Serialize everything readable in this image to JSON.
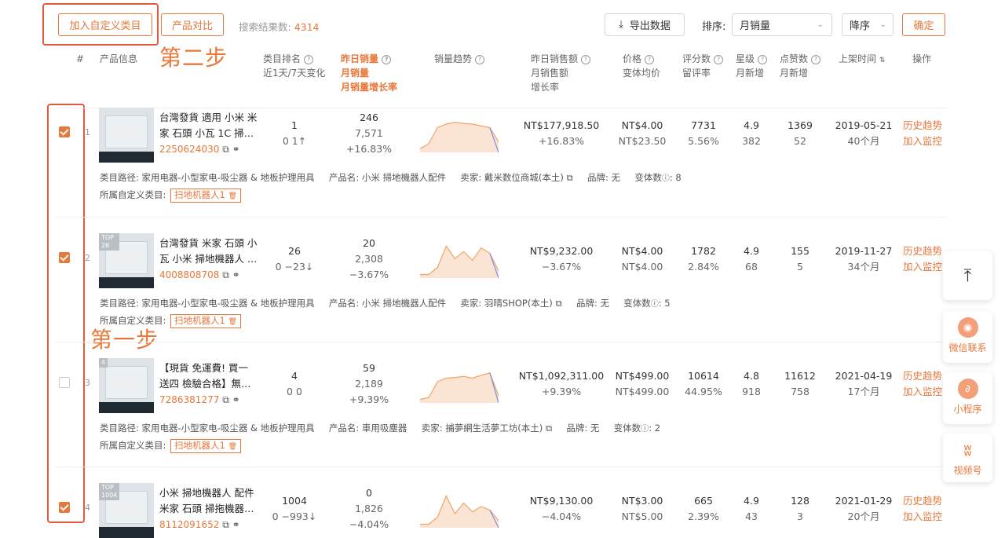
{
  "toolbar": {
    "add_custom_category": "加入自定义类目",
    "product_compare": "产品对比",
    "result_label": "搜索结果数:",
    "result_count": "4314",
    "export": "导出数据",
    "sort_label": "排序:",
    "sort_value": "月销量",
    "order_value": "降序",
    "confirm": "确定"
  },
  "annotations": {
    "step2": "第二步",
    "step1": "第一步"
  },
  "headers": {
    "num": "#",
    "product": "产品信息",
    "cat_rank": "类目排名",
    "cat_rank_sub": "近1天/7天变化",
    "yday_sales": "昨日销量",
    "month_sales": "月销量",
    "month_growth": "月销量增长率",
    "trend": "销量趋势",
    "yday_revenue": "昨日销售额",
    "month_revenue": "月销售额",
    "revenue_growth": "增长率",
    "price": "价格",
    "variant_avg": "变体均价",
    "ratings": "评分数",
    "review_rate": "留评率",
    "stars": "星级",
    "month_new": "月新增",
    "likes": "点赞数",
    "likes_new": "月新增",
    "listed": "上架时间",
    "ops": "操作"
  },
  "rows": [
    {
      "num": "1",
      "title": "台灣發貨 適用 小米 米家 石頭 小瓦 1C 掃…",
      "id": "2250624030",
      "rank": "1",
      "rank_change": "0 1↑",
      "yday": "246",
      "month": "7,571",
      "growth": "+16.83%",
      "yday_rev": "NT$177,918.50",
      "rev_growth": "+16.83%",
      "price": "NT$4.00",
      "variant": "NT$23.50",
      "ratings": "7731",
      "review": "5.56%",
      "stars": "4.9",
      "stars_new": "382",
      "likes": "1369",
      "likes_new": "52",
      "date": "2019-05-21",
      "age": "40个月",
      "history": "历史趋势",
      "monitor": "加入监控",
      "path": "类目路径: 家用电器-小型家电-吸尘器 & 地板护理用具",
      "pname": "产品名: 小米 掃地機器人配件",
      "seller": "卖家: 戴米数位商城(本土)",
      "brand": "品牌: 无",
      "variants": "变体数",
      "variants_count": ": 8",
      "custom": "所属自定义类目:",
      "custom_tag": "扫地机器人1",
      "spark": [
        0.1,
        0.25,
        0.7,
        0.8,
        0.85,
        0.82,
        0.8,
        0.75,
        0.7,
        0.3
      ],
      "thumb_badge": ""
    },
    {
      "num": "2",
      "title": "台灣發貨 米家 石頭 小瓦 小米 掃地機器人 …",
      "id": "4008808708",
      "rank": "26",
      "rank_change": "0 −23↓",
      "yday": "20",
      "month": "2,308",
      "growth": "−3.67%",
      "yday_rev": "NT$9,232.00",
      "rev_growth": "−3.67%",
      "price": "NT$4.00",
      "variant": "NT$4.00",
      "ratings": "1782",
      "review": "2.84%",
      "stars": "4.9",
      "stars_new": "68",
      "likes": "155",
      "likes_new": "5",
      "date": "2019-11-27",
      "age": "34个月",
      "history": "历史趋势",
      "monitor": "加入监控",
      "path": "类目路径: 家用电器-小型家电-吸尘器 & 地板护理用具",
      "pname": "产品名: 小米 掃地機器人配件",
      "seller": "卖家: 羽晴SHOP(本土)",
      "brand": "品牌: 无",
      "variants": "变体数",
      "variants_count": ": 5",
      "custom": "所属自定义类目:",
      "custom_tag": "扫地机器人1",
      "spark": [
        0.1,
        0.1,
        0.3,
        0.9,
        0.55,
        0.75,
        0.5,
        0.85,
        0.7,
        0.2
      ],
      "thumb_badge": "TOP 26"
    },
    {
      "num": "3",
      "title": "【現貨 免運費! 買一送四 檢驗合格】無…",
      "id": "7286381277",
      "rank": "4",
      "rank_change": "0 0",
      "yday": "59",
      "month": "2,189",
      "growth": "+9.39%",
      "yday_rev": "NT$1,092,311.00",
      "rev_growth": "+9.39%",
      "price": "NT$499.00",
      "variant": "NT$499.00",
      "ratings": "10614",
      "review": "44.95%",
      "stars": "4.8",
      "stars_new": "918",
      "likes": "11612",
      "likes_new": "758",
      "date": "2021-04-19",
      "age": "17个月",
      "history": "历史趋势",
      "monitor": "加入监控",
      "path": "类目路径: 家用电器-小型家电-吸尘器 & 地板护理用具",
      "pname": "产品名: 車用吸塵器",
      "seller": "卖家: 捕夢網生活夢工坊(本土)",
      "brand": "品牌: 无",
      "variants": "变体数",
      "variants_count": ": 2",
      "custom": "所属自定义类目:",
      "custom_tag": "扫地机器人1",
      "spark": [
        0.1,
        0.15,
        0.6,
        0.7,
        0.72,
        0.75,
        0.7,
        0.78,
        0.85,
        0.2
      ],
      "thumb_badge": "4"
    },
    {
      "num": "4",
      "title": "小米 掃地機器人 配件 米家 石頭 掃拖機器…",
      "id": "8112091652",
      "rank": "1004",
      "rank_change": "0 −993↓",
      "yday": "0",
      "month": "1,826",
      "growth": "−4.04%",
      "yday_rev": "NT$9,130.00",
      "rev_growth": "−4.04%",
      "price": "NT$3.00",
      "variant": "NT$5.00",
      "ratings": "665",
      "review": "2.39%",
      "stars": "4.9",
      "stars_new": "43",
      "likes": "128",
      "likes_new": "3",
      "date": "2021-01-29",
      "age": "20个月",
      "history": "历史趋势",
      "monitor": "加入监控",
      "spark": [
        0.1,
        0.1,
        0.3,
        0.9,
        0.4,
        0.7,
        0.45,
        0.6,
        0.5,
        0.2
      ],
      "thumb_badge": "TOP 1004"
    }
  ],
  "side": {
    "wechat": "微信联系",
    "mini": "小程序",
    "video": "视频号"
  }
}
